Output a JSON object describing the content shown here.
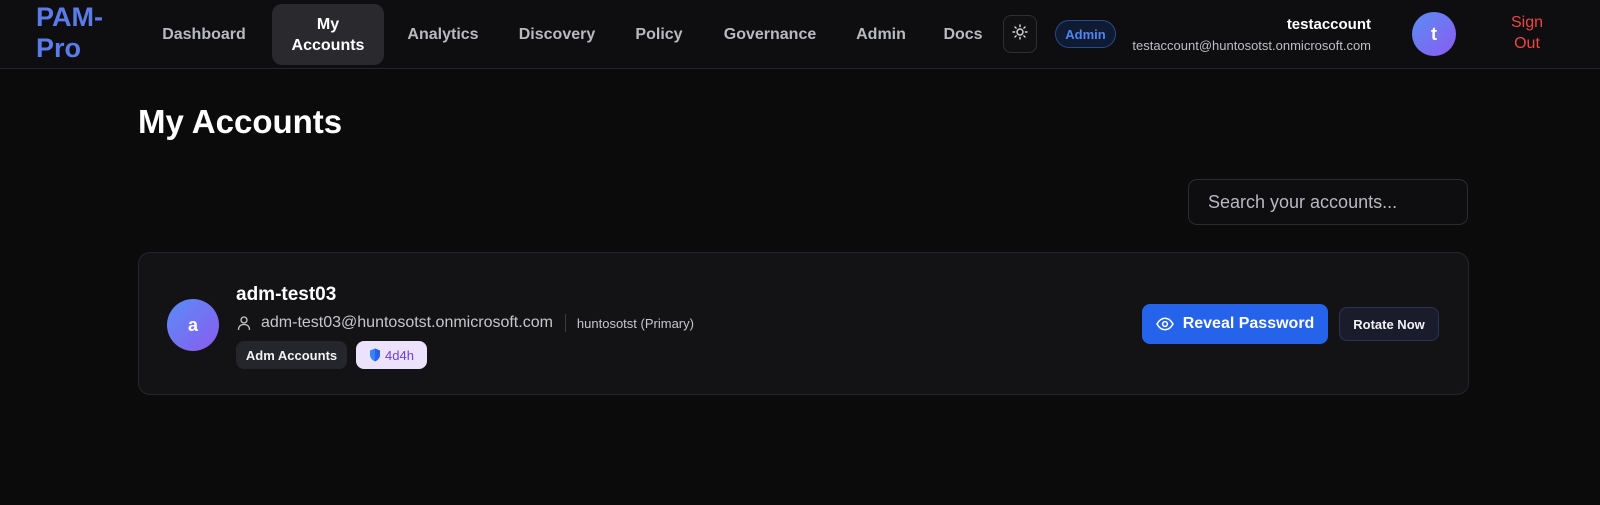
{
  "app": {
    "logo": "PAM-Pro"
  },
  "nav": {
    "items": [
      {
        "label": "Dashboard"
      },
      {
        "label": "My Accounts"
      },
      {
        "label": "Analytics"
      },
      {
        "label": "Discovery"
      },
      {
        "label": "Policy"
      },
      {
        "label": "Governance"
      },
      {
        "label": "Admin"
      },
      {
        "label": "Docs"
      }
    ],
    "active": "My Accounts",
    "theme_icon": "sun-icon",
    "role_badge": "Admin"
  },
  "user": {
    "name": "testaccount",
    "email": "testaccount@huntosotst.onmicrosoft.com",
    "avatar_initial": "t",
    "sign_out": "Sign Out"
  },
  "page": {
    "title": "My Accounts"
  },
  "search": {
    "placeholder": "Search your accounts..."
  },
  "accounts": [
    {
      "avatar_initial": "a",
      "name": "adm-test03",
      "email": "adm-test03@huntosotst.onmicrosoft.com",
      "domain": "huntosotst (Primary)",
      "group": "Adm Accounts",
      "ttl": "4d4h",
      "reveal_label": "Reveal Password",
      "rotate_label": "Rotate Now"
    }
  ],
  "colors": {
    "accent": "#2563eb",
    "logo": "#5b7bea",
    "sign_out": "#ef4444",
    "ttl_badge_bg": "#ece2fb",
    "ttl_badge_text": "#6d3fd6"
  }
}
